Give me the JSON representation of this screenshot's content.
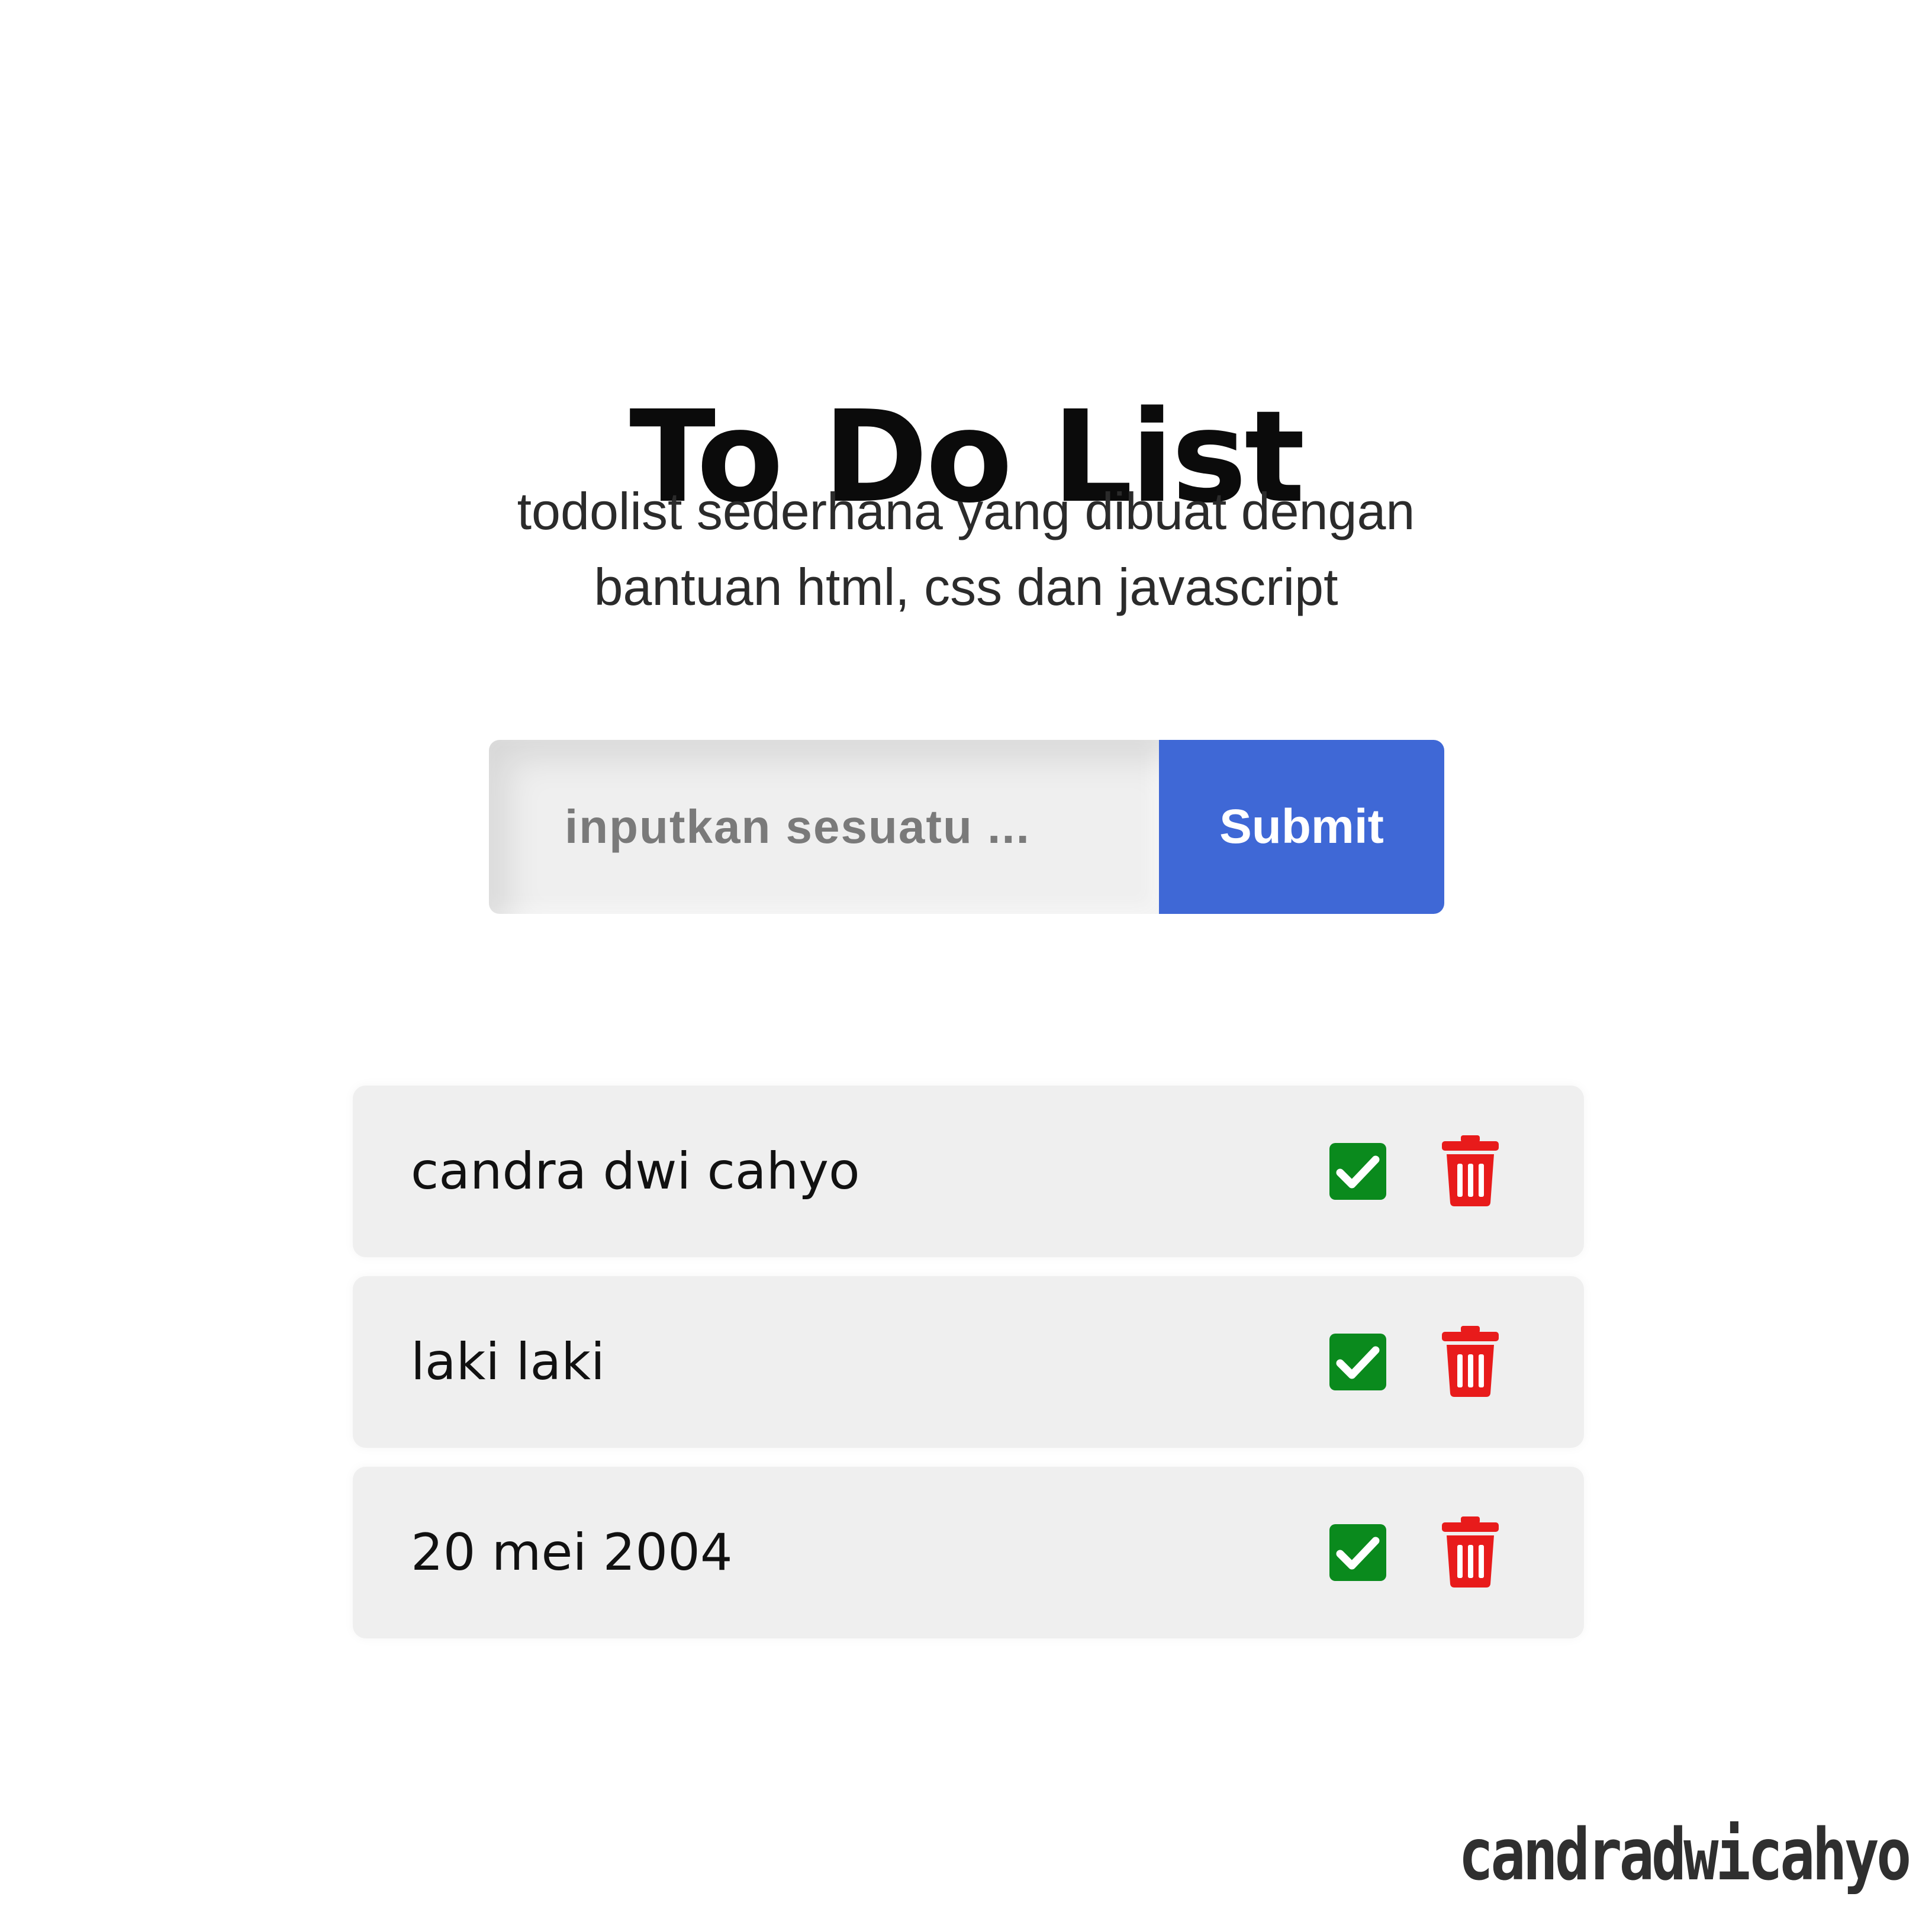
{
  "header": {
    "title": "To Do List",
    "subtitle_line1": "todolist sederhana yang dibuat dengan",
    "subtitle_line2": "bantuan html, css dan javascript"
  },
  "form": {
    "input_placeholder": "inputkan sesuatu ...",
    "input_value": "",
    "submit_label": "Submit"
  },
  "todos": [
    {
      "text": "candra dwi cahyo",
      "check_icon": "check-square-icon",
      "delete_icon": "trash-icon"
    },
    {
      "text": "laki laki",
      "check_icon": "check-square-icon",
      "delete_icon": "trash-icon"
    },
    {
      "text": "20 mei 2004",
      "check_icon": "check-square-icon",
      "delete_icon": "trash-icon"
    }
  ],
  "colors": {
    "submit_bg": "#3f68d6",
    "check": "#0a8a1d",
    "trash": "#e81b1b",
    "item_bg": "#efefef"
  },
  "watermark": "candradwicahyo"
}
